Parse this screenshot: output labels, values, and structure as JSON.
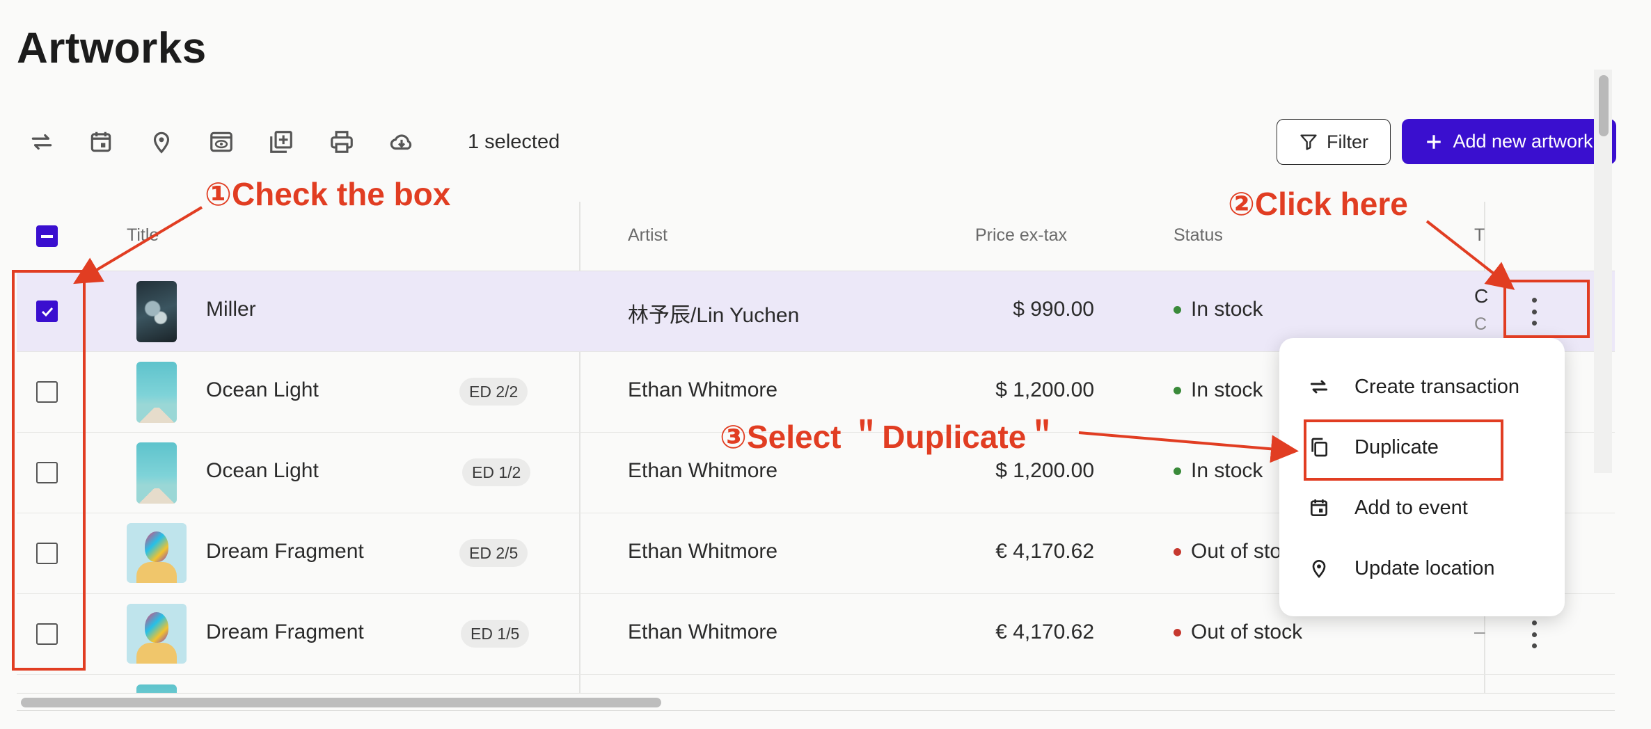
{
  "page": {
    "title": "Artworks"
  },
  "toolbar": {
    "icons": [
      "swap-arrows-icon",
      "calendar-icon",
      "location-pin-icon",
      "preview-icon",
      "add-copy-icon",
      "print-icon",
      "cloud-download-icon"
    ],
    "selected_count": "1 selected",
    "filter_label": "Filter",
    "add_label": "Add new artwork",
    "accent_color": "#3a0fcf"
  },
  "table": {
    "headers": {
      "title": "Title",
      "artist": "Artist",
      "price": "Price ex-tax",
      "status": "Status",
      "truncated": "T"
    },
    "rows": [
      {
        "title": "Miller",
        "edition": "",
        "artist": "林予辰/Lin Yuchen",
        "price": "$  990.00",
        "status": "In stock",
        "status_color": "#3a8a3a",
        "selected": true,
        "trunc_line1": "C",
        "trunc_line2": "C"
      },
      {
        "title": "Ocean Light",
        "edition": "ED 2/2",
        "artist": "Ethan Whitmore",
        "price": "$  1,200.00",
        "status": "In stock",
        "status_color": "#3a8a3a",
        "selected": false
      },
      {
        "title": "Ocean Light",
        "edition": "ED 1/2",
        "artist": "Ethan Whitmore",
        "price": "$  1,200.00",
        "status": "In stock",
        "status_color": "#3a8a3a",
        "selected": false
      },
      {
        "title": "Dream Fragment",
        "edition": "ED 2/5",
        "artist": "Ethan Whitmore",
        "price": "€  4,170.62",
        "status": "Out of sto",
        "status_color": "#c6392f",
        "selected": false
      },
      {
        "title": "Dream Fragment",
        "edition": "ED 1/5",
        "artist": "Ethan Whitmore",
        "price": "€  4,170.62",
        "status": "Out of stock",
        "status_color": "#c6392f",
        "selected": false,
        "trunc_line1": "–"
      }
    ]
  },
  "context_menu": {
    "items": [
      {
        "label": "Create transaction",
        "icon": "swap-arrows-icon"
      },
      {
        "label": "Duplicate",
        "icon": "copy-icon"
      },
      {
        "label": "Add to event",
        "icon": "calendar-icon"
      },
      {
        "label": "Update location",
        "icon": "location-pin-icon"
      }
    ]
  },
  "annotations": {
    "step1": "①Check the box",
    "step2": "②Click here",
    "step3": "③Select ＂Duplicate＂",
    "color": "#e13d22"
  }
}
